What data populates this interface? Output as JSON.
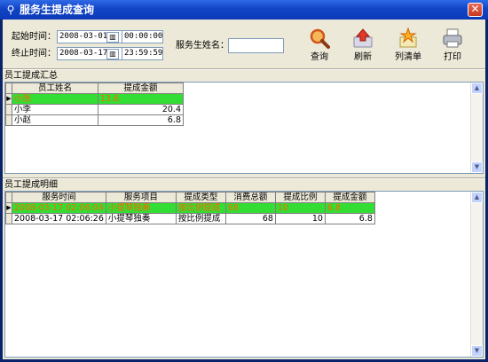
{
  "window": {
    "title": "服务生提成查询",
    "close_label": "✕"
  },
  "filters": {
    "start_label": "起始时间：",
    "start_date": "2008-03-01",
    "start_time": "00:00:00",
    "end_label": "终止时间：",
    "end_date": "2008-03-17",
    "end_time": "23:59:59",
    "name_label": "服务生姓名：",
    "name_value": "",
    "calendar_glyph": "▥"
  },
  "toolbar": {
    "query_label": "查询",
    "refresh_label": "刷新",
    "list_label": "列清单",
    "print_label": "打印"
  },
  "summary": {
    "section_title": "员工提成汇总",
    "columns": [
      "员工姓名",
      "提成金额"
    ],
    "rows": [
      {
        "name": "小张",
        "amount": "13.6"
      },
      {
        "name": "小李",
        "amount": "20.4"
      },
      {
        "name": "小赵",
        "amount": "6.8"
      }
    ]
  },
  "detail": {
    "section_title": "员工提成明细",
    "columns": [
      "服务时间",
      "服务项目",
      "提成类型",
      "消费总额",
      "提成比例",
      "提成金额"
    ],
    "rows": [
      {
        "time": "2008-03-17 02:06:04",
        "item": "小提琴独奏",
        "type": "按比例提成",
        "total": "68",
        "ratio": "10",
        "amount": "6.8"
      },
      {
        "time": "2008-03-17 02:06:26",
        "item": "小提琴独奏",
        "type": "按比例提成",
        "total": "68",
        "ratio": "10",
        "amount": "6.8"
      }
    ]
  },
  "colors": {
    "selected_row_bg": "#33DD33",
    "selected_row_text": "#FF6600",
    "titlebar": "#1145C6"
  }
}
